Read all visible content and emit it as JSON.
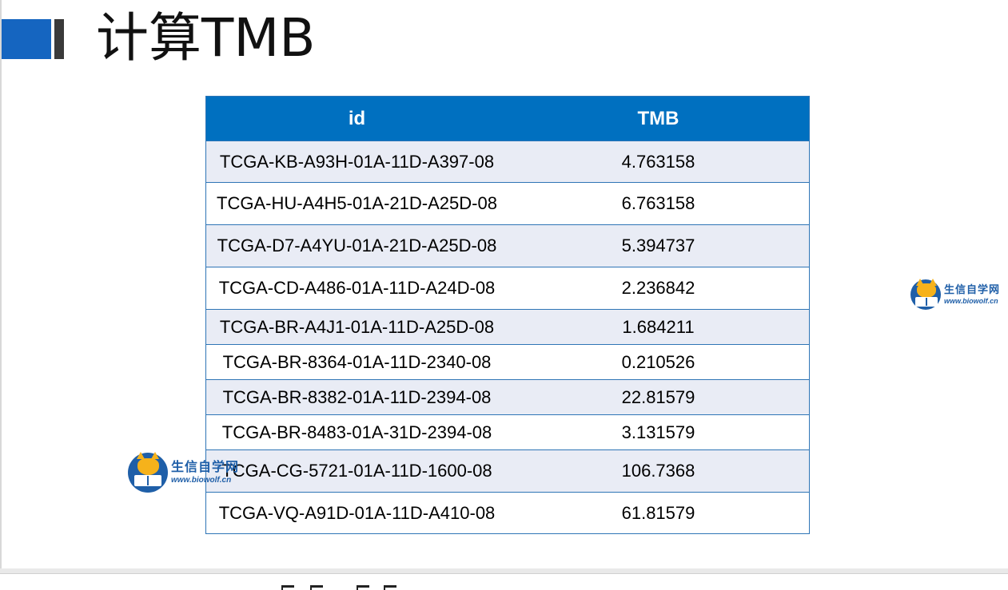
{
  "slide": {
    "title": "计算TMB"
  },
  "table": {
    "headers": [
      "id",
      "TMB"
    ],
    "rows": [
      {
        "id": "TCGA-KB-A93H-01A-11D-A397-08",
        "tmb": "4.763158"
      },
      {
        "id": "TCGA-HU-A4H5-01A-21D-A25D-08",
        "tmb": "6.763158"
      },
      {
        "id": "TCGA-D7-A4YU-01A-21D-A25D-08",
        "tmb": "5.394737"
      },
      {
        "id": "TCGA-CD-A486-01A-11D-A24D-08",
        "tmb": "2.236842"
      },
      {
        "id": "TCGA-BR-A4J1-01A-11D-A25D-08",
        "tmb": "1.684211"
      },
      {
        "id": "TCGA-BR-8364-01A-11D-2340-08",
        "tmb": "0.210526"
      },
      {
        "id": "TCGA-BR-8382-01A-11D-2394-08",
        "tmb": "22.81579"
      },
      {
        "id": "TCGA-BR-8483-01A-31D-2394-08",
        "tmb": "3.131579"
      },
      {
        "id": "TCGA-CG-5721-01A-11D-1600-08",
        "tmb": "106.7368"
      },
      {
        "id": "TCGA-VQ-A91D-01A-11D-A410-08",
        "tmb": "61.81579"
      }
    ]
  },
  "watermarks": [
    {
      "name": "生信自学网",
      "url": "www.biowolf.cn",
      "icon": "wolf-book-logo-icon"
    },
    {
      "name": "生信自学网",
      "url": "www.biowolf.cn",
      "icon": "wolf-book-logo-icon"
    }
  ],
  "colors": {
    "header_bg": "#0070c0",
    "row_alt_bg": "#e9ecf5",
    "accent_block": "#1565c0",
    "border": "#2e75b6"
  }
}
